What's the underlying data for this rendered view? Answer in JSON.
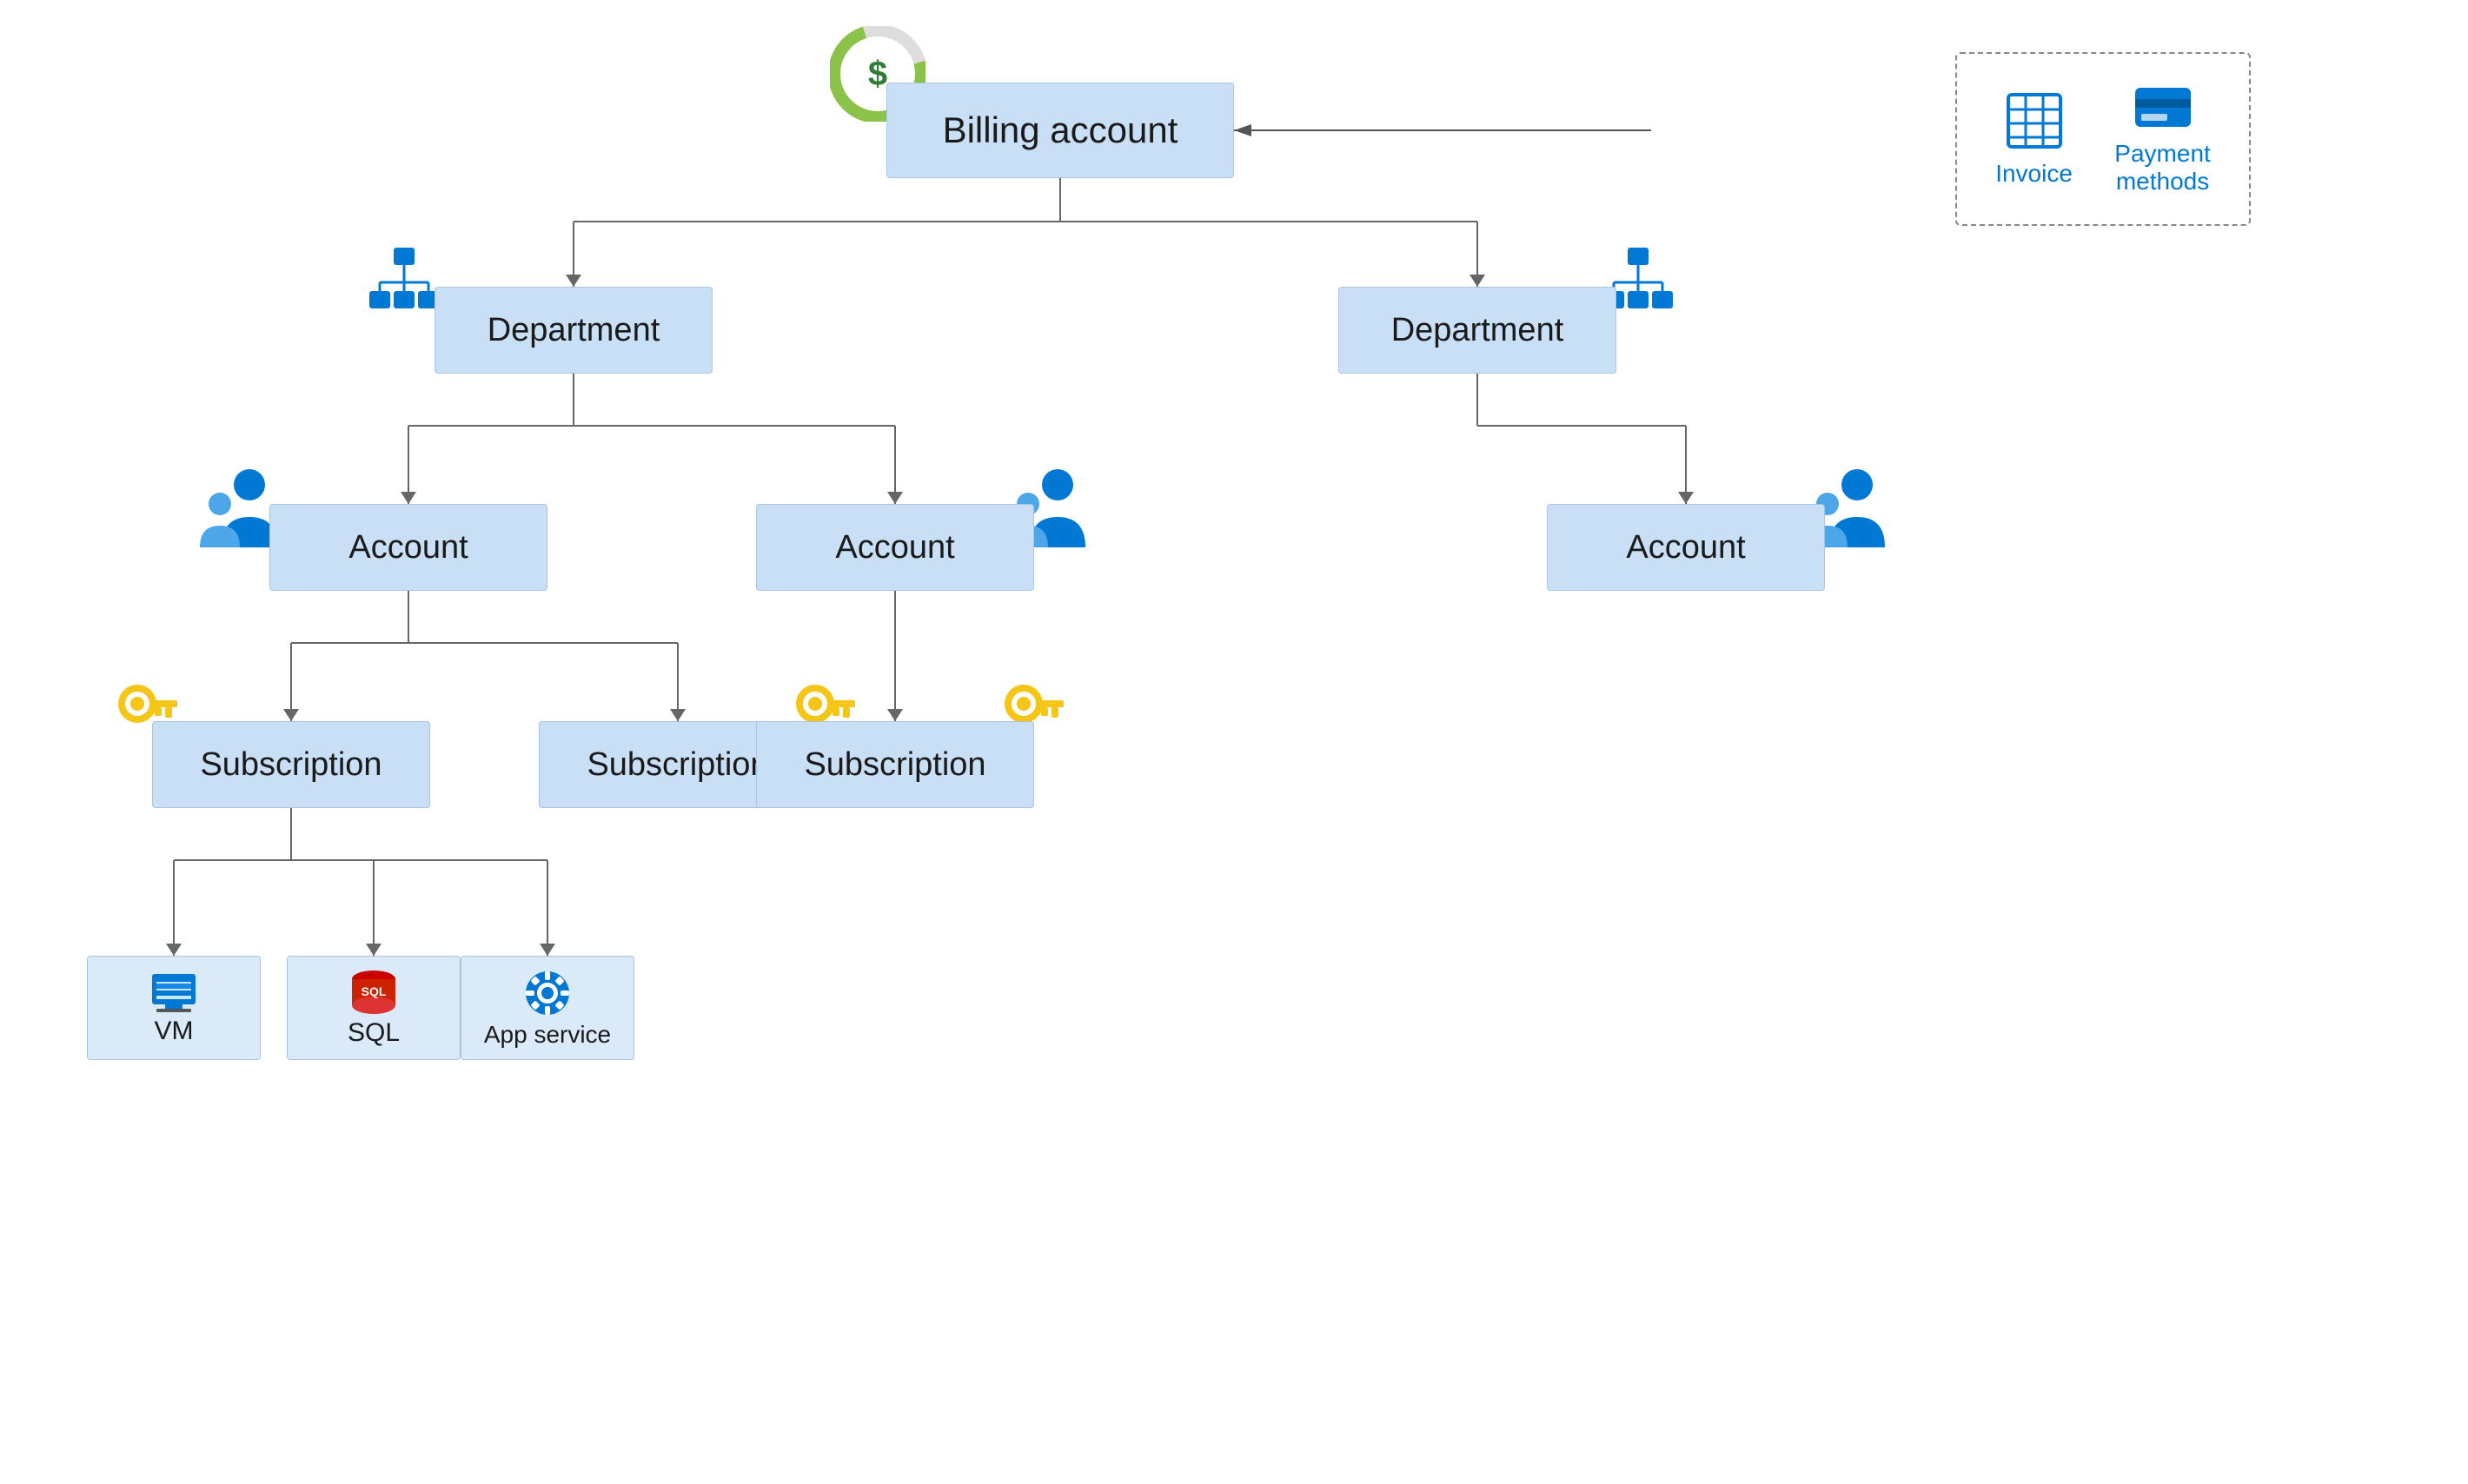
{
  "billing": {
    "label": "Billing account",
    "icon_label": "billing-icon"
  },
  "departments": [
    {
      "label": "Department",
      "id": "dept1"
    },
    {
      "label": "Department",
      "id": "dept2"
    }
  ],
  "accounts": [
    {
      "label": "Account",
      "id": "account1"
    },
    {
      "label": "Account",
      "id": "account2"
    },
    {
      "label": "Account",
      "id": "account3"
    }
  ],
  "subscriptions": [
    {
      "label": "Subscription",
      "id": "sub1"
    },
    {
      "label": "Subscription",
      "id": "sub2"
    },
    {
      "label": "Subscription",
      "id": "sub3"
    }
  ],
  "resources": [
    {
      "label": "VM",
      "id": "vm"
    },
    {
      "label": "SQL",
      "id": "sql"
    },
    {
      "label": "App service",
      "id": "app-service"
    }
  ],
  "invoice_box": {
    "item1_label": "Invoice",
    "item2_label": "Payment\nmethods"
  },
  "colors": {
    "node_bg": "#c8dff5",
    "node_border": "#a8c4e0",
    "line_color": "#666",
    "blue": "#0078d4",
    "accent_green": "#7cb342",
    "gold": "#f5c518"
  }
}
